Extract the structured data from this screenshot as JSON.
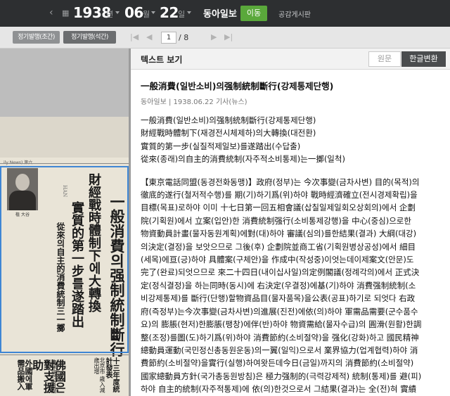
{
  "topbar": {
    "year": "1938",
    "year_unit": "년",
    "month": "06",
    "month_unit": "월",
    "day": "22",
    "day_unit": "일",
    "newspaper": "동아일보",
    "go_label": "이동",
    "notice_label": "공감게시판",
    "icons": [
      "back-icon",
      "calendar-icon"
    ]
  },
  "toolbar": {
    "tab1": "정기발행(조간)",
    "tab2": "정기발행(석간)",
    "page_current": "1",
    "page_total": "/ 8",
    "icons": [
      "first-page-icon",
      "prev-page-icon",
      "next-page-icon",
      "last-page-icon"
    ]
  },
  "scan": {
    "masthead": "ily News) 第六",
    "headline1": "一般消費의强制統制斷行",
    "headline2": "財經戰時體制下에大轉換",
    "headline3": "實質的第一步를遂踏出",
    "headline4": "從來의自主的消費統制三一擲",
    "photo_caption": "植 大谷",
    "sub1": "十三年度統計發表",
    "sub2": "北京市 歲入減 歲出增",
    "side1": "佛國은對支援助",
    "side2": "外國에軍需品搬入",
    "side3": "陳述했記者團에게",
    "side_mark": "HAN"
  },
  "right": {
    "header_title": "텍스트 보기",
    "btn_original": "원문",
    "btn_hangul": "한글변환",
    "article_title": "一般消費(일반소비)의强制統制斷行(강제통제단행)",
    "article_meta": "동아일보 | 1938.06.22 기사(뉴스)",
    "lead": "一般消費(일반소비)의强制統制斷行(강제통제단행)\n財經戰時體制下(재경전시체제하)의大轉換(대전환)\n實質的第一步(실질적제일보)를遂踏出(수답출)\n從來(종래)의自主的消費統制(자주적소비통제)는一擲(일척)",
    "body": "【東京電話同盟(동경전화동맹)】政府(정부)는 今次事變(금차사변) 目的(목적)의\n徹底的遂行(철저적수행)를 期(기)하기爲(위)하야 戰時經濟確立(전시경제확립)을\n目標(목표)로하야 이미 十七日第一回五相會議(삽칠일제일회오상회의)에서 企劃\n院(기획원)에서 立案(입안)한 消費統制强行(소비통제강행)을 中心(중심)으로한\n物資動員計畫(물자동원계획)에對(대)하야 審議(심의)를한結果(결과) 大綱(대강)\n의決定(결정)을 보앗으므로 그後(후) 企劃院並商工省(기획원병상공성)에서 細目\n(세목)에亘(긍)하야 具體案(구체안)을 作成中(작성중)이엇는데이제案文(안문)도\n完了(완료)되엇으므로 來二十四日(내이십사일)의定例閣議(정례각의)에서 正式決\n定(정식결정)을 하는同時(동시)에 右決定(우결정)에基(기)하야 消費强制統制(소\n비강제통제)를 斷行(단행)할物資品目(물자품목)을公表(공표)하기로 되엇다 右政\n府(즉정부)는今次事變(금차사변)의進展(진전)에依(의)하야 軍需品需要(군수품수\n요)의 膨脹(현저)한膨脹(팽창)에伴(반)하야 物資需給(물자수급)의 圓滑(원활)한調\n整(조정)를圖(도)하기爲(위)하야 消費節約(소비절약)을 强化(강화)하고 國民精神\n總動員運動(국민정신총동원운동)의一翼(일익)으로서 業界協力(업계협력)하야 消\n費節約(소비절약)을實行(실행)하여왓든데今日(금일)까지의 消費節約(소비절약)\n國家總動員方針(국가총동원방침)은 極力强制的(극력강제적) 統制(통제)를 避(피)\n하야 自主的統制(자주적통제)에 依(의)한것으로서 그結果(결과)는 全(전)혀 實績"
  }
}
